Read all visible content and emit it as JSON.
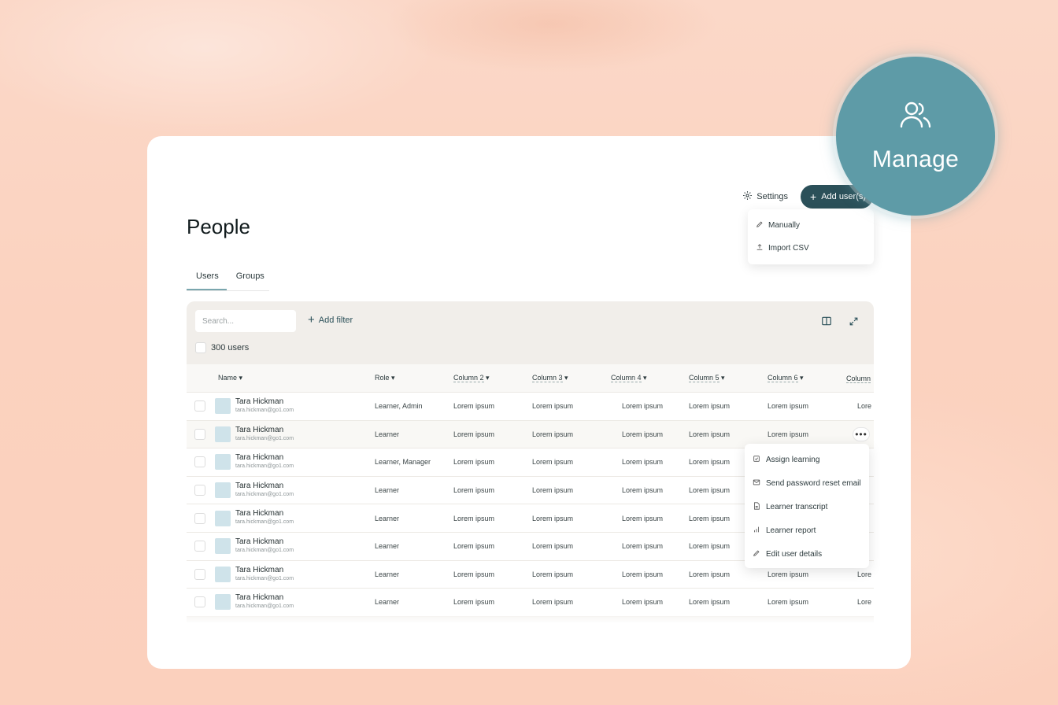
{
  "badge": {
    "label": "Manage",
    "icon": "users-icon"
  },
  "header": {
    "settings_label": "Settings",
    "add_users_label": "Add user(s)"
  },
  "add_menu": [
    {
      "label": "Manually",
      "icon": "pencil-icon"
    },
    {
      "label": "Import CSV",
      "icon": "upload-icon"
    }
  ],
  "page": {
    "title": "People"
  },
  "tabs": [
    {
      "label": "Users",
      "active": true
    },
    {
      "label": "Groups",
      "active": false
    }
  ],
  "search": {
    "placeholder": "Search..."
  },
  "filter": {
    "add_label": "Add filter"
  },
  "count_label": "300 users",
  "columns": [
    "Name",
    "Role",
    "Column 2",
    "Column 3",
    "Column 4",
    "Column 5",
    "Column 6",
    "Column"
  ],
  "rows": [
    {
      "name": "Tara Hickman",
      "email": "tara.hickman@go1.com",
      "role": "Learner, Admin",
      "c2": "Lorem ipsum",
      "c3": "Lorem ipsum",
      "c4": "Lorem ipsum",
      "c5": "Lorem ipsum",
      "c6": "Lorem ipsum",
      "c7": "Lore"
    },
    {
      "name": "Tara Hickman",
      "email": "tara.hickman@go1.com",
      "role": "Learner",
      "c2": "Lorem ipsum",
      "c3": "Lorem ipsum",
      "c4": "Lorem ipsum",
      "c5": "Lorem ipsum",
      "c6": "Lorem ipsum",
      "c7": ""
    },
    {
      "name": "Tara Hickman",
      "email": "tara.hickman@go1.com",
      "role": "Learner, Manager",
      "c2": "Lorem ipsum",
      "c3": "Lorem ipsum",
      "c4": "Lorem ipsum",
      "c5": "Lorem ipsum",
      "c6": "",
      "c7": ""
    },
    {
      "name": "Tara Hickman",
      "email": "tara.hickman@go1.com",
      "role": "Learner",
      "c2": "Lorem ipsum",
      "c3": "Lorem ipsum",
      "c4": "Lorem ipsum",
      "c5": "Lorem ipsum",
      "c6": "",
      "c7": ""
    },
    {
      "name": "Tara Hickman",
      "email": "tara.hickman@go1.com",
      "role": "Learner",
      "c2": "Lorem ipsum",
      "c3": "Lorem ipsum",
      "c4": "Lorem ipsum",
      "c5": "Lorem ipsum",
      "c6": "",
      "c7": ""
    },
    {
      "name": "Tara Hickman",
      "email": "tara.hickman@go1.com",
      "role": "Learner",
      "c2": "Lorem ipsum",
      "c3": "Lorem ipsum",
      "c4": "Lorem ipsum",
      "c5": "Lorem ipsum",
      "c6": "",
      "c7": ""
    },
    {
      "name": "Tara Hickman",
      "email": "tara.hickman@go1.com",
      "role": "Learner",
      "c2": "Lorem ipsum",
      "c3": "Lorem ipsum",
      "c4": "Lorem ipsum",
      "c5": "Lorem ipsum",
      "c6": "Lorem ipsum",
      "c7": "Lore"
    },
    {
      "name": "Tara Hickman",
      "email": "tara.hickman@go1.com",
      "role": "Learner",
      "c2": "Lorem ipsum",
      "c3": "Lorem ipsum",
      "c4": "Lorem ipsum",
      "c5": "Lorem ipsum",
      "c6": "Lorem ipsum",
      "c7": "Lore"
    }
  ],
  "row_menu": [
    {
      "label": "Assign learning",
      "icon": "assign-icon"
    },
    {
      "label": "Send password reset email",
      "icon": "mail-icon"
    },
    {
      "label": "Learner transcript",
      "icon": "document-icon"
    },
    {
      "label": "Learner report",
      "icon": "chart-icon"
    },
    {
      "label": "Edit user details",
      "icon": "pencil-icon"
    }
  ],
  "colors": {
    "accent": "#2b5059",
    "badge": "#5e9ba7",
    "background": "#fbd2bf"
  }
}
